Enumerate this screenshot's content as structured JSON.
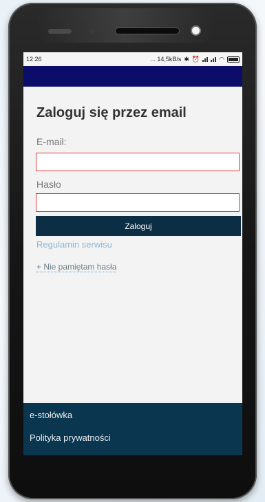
{
  "status_bar": {
    "time": "12:26",
    "network_speed": "... 14,5kB/s",
    "icons": [
      "bluetooth-icon",
      "alarm-icon",
      "signal-icon",
      "signal-icon",
      "wifi-icon",
      "battery-icon"
    ]
  },
  "app_bar": {
    "color": "#0c0c6a"
  },
  "login": {
    "title": "Zaloguj się przez email",
    "email_label": "E-mail:",
    "email_value": "",
    "password_label": "Hasło",
    "password_value": "",
    "submit_label": "Zaloguj",
    "terms_link": "Regulamin serwisu",
    "forgot_link": "+ Nie pamiętam hasła"
  },
  "footer": {
    "links": [
      "e-stołówka",
      "Polityka prywatności"
    ]
  },
  "colors": {
    "field_border": "#e23a3a",
    "button_bg": "#0b2e45",
    "footer_bg": "#0b3650",
    "link": "#8fb7cf"
  }
}
